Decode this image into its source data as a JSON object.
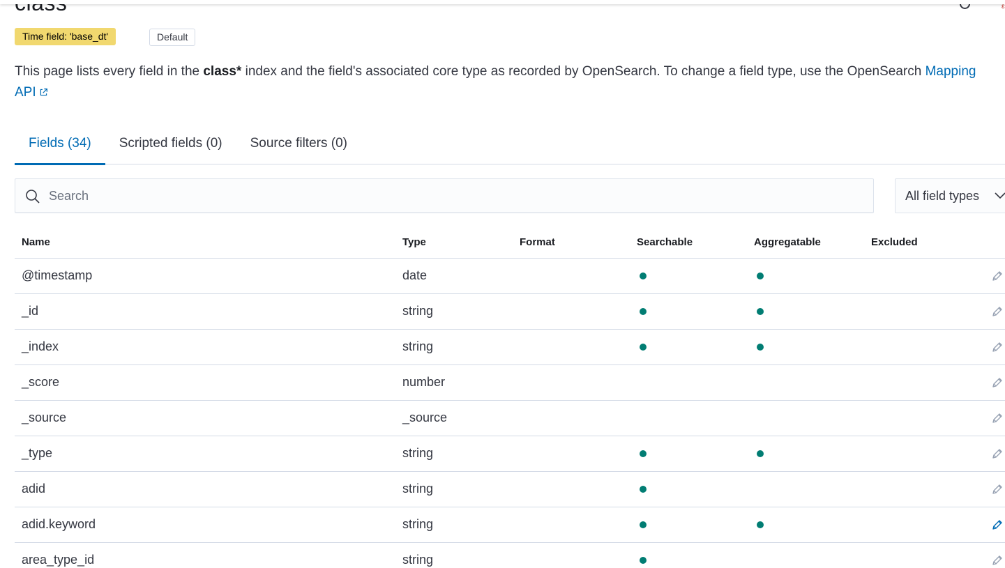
{
  "header": {
    "title": "class",
    "title_suffix": "*",
    "time_field_badge": "Time field: 'base_dt'",
    "default_badge": "Default"
  },
  "description": {
    "part1": "This page lists every field in the ",
    "index_name": "class*",
    "part2": " index and the field's associated core type as recorded by OpenSearch. To change a field type, use the OpenSearch ",
    "link_text": "Mapping API"
  },
  "tabs": [
    {
      "label": "Fields (34)",
      "active": true
    },
    {
      "label": "Scripted fields (0)",
      "active": false
    },
    {
      "label": "Source filters (0)",
      "active": false
    }
  ],
  "search": {
    "placeholder": "Search",
    "value": ""
  },
  "type_filter": {
    "label": "All field types"
  },
  "table": {
    "columns": [
      "Name",
      "Type",
      "Format",
      "Searchable",
      "Aggregatable",
      "Excluded"
    ],
    "rows": [
      {
        "name": "@timestamp",
        "type": "date",
        "format": "",
        "searchable": true,
        "aggregatable": true,
        "excluded": false
      },
      {
        "name": "_id",
        "type": "string",
        "format": "",
        "searchable": true,
        "aggregatable": true,
        "excluded": false
      },
      {
        "name": "_index",
        "type": "string",
        "format": "",
        "searchable": true,
        "aggregatable": true,
        "excluded": false
      },
      {
        "name": "_score",
        "type": "number",
        "format": "",
        "searchable": false,
        "aggregatable": false,
        "excluded": false
      },
      {
        "name": "_source",
        "type": "_source",
        "format": "",
        "searchable": false,
        "aggregatable": false,
        "excluded": false
      },
      {
        "name": "_type",
        "type": "string",
        "format": "",
        "searchable": true,
        "aggregatable": true,
        "excluded": false
      },
      {
        "name": "adid",
        "type": "string",
        "format": "",
        "searchable": true,
        "aggregatable": false,
        "excluded": false
      },
      {
        "name": "adid.keyword",
        "type": "string",
        "format": "",
        "searchable": true,
        "aggregatable": true,
        "excluded": false,
        "hovered": true
      },
      {
        "name": "area_type_id",
        "type": "string",
        "format": "",
        "searchable": true,
        "aggregatable": false,
        "excluded": false
      }
    ]
  },
  "colors": {
    "accent": "#006bb4",
    "dot": "#017d73",
    "badge": "#f1d86f",
    "pencil": "#98a2b3"
  },
  "icons": {
    "search": "search-icon",
    "chevron": "chevron-down-icon",
    "edit": "pencil-icon",
    "external": "external-link-icon"
  }
}
